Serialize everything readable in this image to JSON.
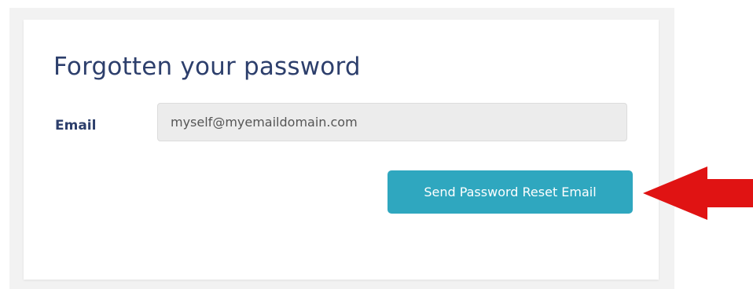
{
  "form": {
    "title": "Forgotten your password",
    "email_label": "Email",
    "email_value": "myself@myemaildomain.com",
    "submit_label": "Send Password Reset Email"
  },
  "colors": {
    "accent": "#2fa7bf",
    "heading": "#2d3f6c",
    "annotation_arrow": "#e01313"
  },
  "icons": {
    "annotation": "red-arrow-icon"
  }
}
